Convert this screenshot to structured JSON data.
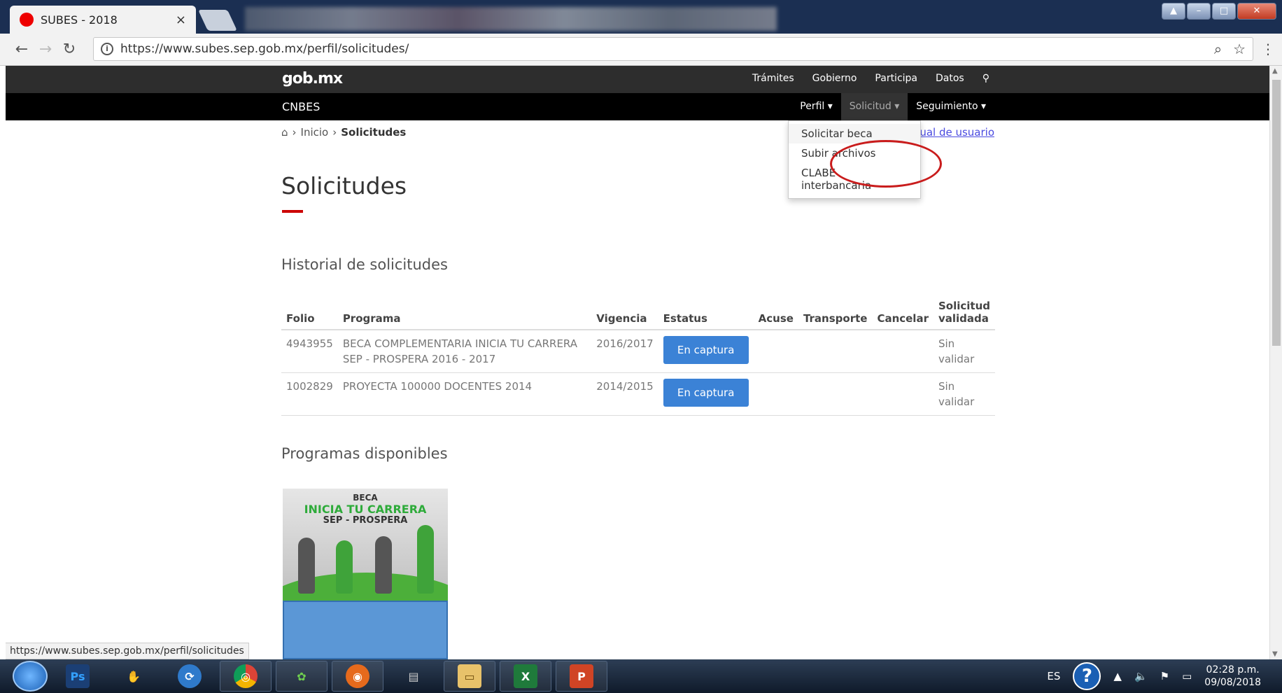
{
  "browser": {
    "tab_title": "SUBES - 2018",
    "tab_close": "×",
    "url": "https://www.subes.sep.gob.mx/perfil/solicitudes/",
    "status_url": "https://www.subes.sep.gob.mx/perfil/solicitudes"
  },
  "gob": {
    "logo": "gob.mx",
    "nav": [
      "Trámites",
      "Gobierno",
      "Participa",
      "Datos"
    ]
  },
  "cnbes": {
    "title": "CNBES",
    "menu": [
      {
        "label": "Perfil ▾"
      },
      {
        "label": "Solicitud ▾"
      },
      {
        "label": "Seguimiento ▾"
      }
    ],
    "dropdown": [
      "Solicitar beca",
      "Subir archivos",
      "CLABE interbancaria"
    ]
  },
  "breadcrumb": {
    "home": "⌂",
    "sep1": "›",
    "inicio": "Inicio",
    "sep2": "›",
    "current": "Solicitudes"
  },
  "manual_link": "Manual de usuario",
  "page": {
    "title": "Solicitudes",
    "historial_title": "Historial de solicitudes",
    "programas_title": "Programas disponibles"
  },
  "table": {
    "headers": [
      "Folio",
      "Programa",
      "Vigencia",
      "Estatus",
      "Acuse",
      "Transporte",
      "Cancelar",
      "Solicitud validada"
    ],
    "rows": [
      {
        "folio": "4943955",
        "programa": "BECA COMPLEMENTARIA INICIA TU CARRERA SEP - PROSPERA 2016 - 2017",
        "vigencia": "2016/2017",
        "estatus": "En captura",
        "validada": "Sin validar"
      },
      {
        "folio": "1002829",
        "programa": "PROYECTA 100000 DOCENTES 2014",
        "vigencia": "2014/2015",
        "estatus": "En captura",
        "validada": "Sin validar"
      }
    ]
  },
  "program_card": {
    "line1": "BECA",
    "line2": "INICIA TU CARRERA",
    "line3": "SEP - PROSPERA"
  },
  "taskbar": {
    "apps": [
      "Ps",
      "✋",
      "⟳",
      "◎",
      "✿",
      "◉",
      "▤",
      "▭",
      "X",
      "P"
    ],
    "lang": "ES",
    "time": "02:28 p.m.",
    "date": "09/08/2018"
  }
}
